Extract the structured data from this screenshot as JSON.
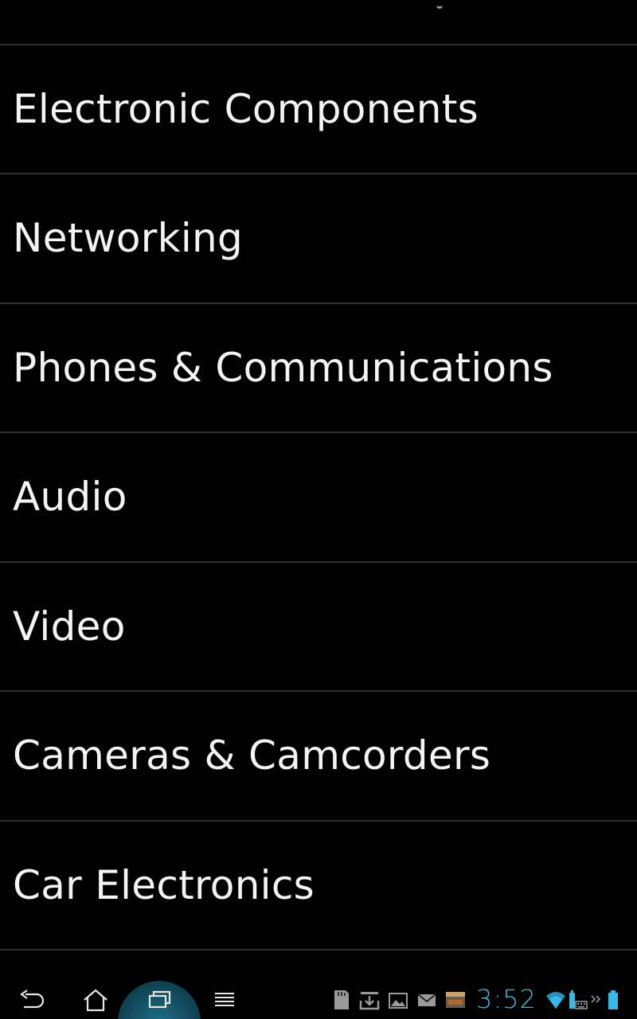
{
  "categories": [
    {
      "label": "Electronic Components"
    },
    {
      "label": "Networking"
    },
    {
      "label": "Phones & Communications"
    },
    {
      "label": "Audio"
    },
    {
      "label": "Video"
    },
    {
      "label": "Cameras & Camcorders"
    },
    {
      "label": "Car Electronics"
    }
  ],
  "system_bar": {
    "clock": "3:52",
    "clock_color": "#38b8e8",
    "recent_glow_color": "#1f6f86",
    "nav_icons": [
      "back-icon",
      "home-icon",
      "recent-apps-icon",
      "menu-icon"
    ],
    "notification_icons": [
      "sd-card-icon",
      "download-icon",
      "gallery-icon",
      "email-icon",
      "amazon-app-icon"
    ],
    "status_icons": [
      "wifi-icon",
      "battery-keyboard-icon",
      "more-chevron-icon",
      "battery-icon"
    ]
  }
}
